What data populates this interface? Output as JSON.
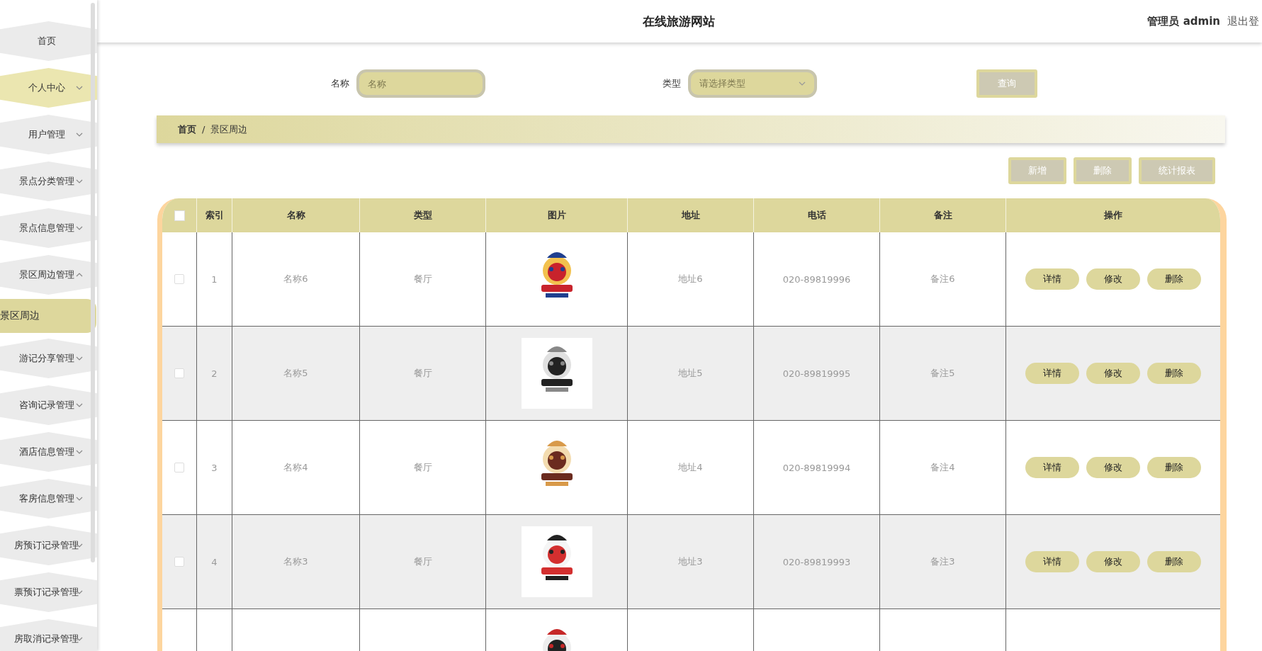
{
  "header": {
    "title": "在线旅游网站",
    "user": "管理员 admin",
    "logout": "退出登"
  },
  "sidebar": {
    "items": [
      {
        "label": "首页",
        "kind": "link",
        "selected": false
      },
      {
        "label": "个人中心",
        "kind": "submenu",
        "selected": true,
        "expanded": false
      },
      {
        "label": "用户管理",
        "kind": "submenu",
        "selected": false,
        "expanded": false
      },
      {
        "label": "景点分类管理",
        "kind": "submenu",
        "selected": false,
        "expanded": false
      },
      {
        "label": "景点信息管理",
        "kind": "submenu",
        "selected": false,
        "expanded": false
      },
      {
        "label": "景区周边管理",
        "kind": "submenu",
        "selected": false,
        "expanded": true,
        "children": [
          {
            "label": "景区周边",
            "selected": true
          }
        ]
      },
      {
        "label": "游记分享管理",
        "kind": "submenu",
        "selected": false,
        "expanded": false
      },
      {
        "label": "咨询记录管理",
        "kind": "submenu",
        "selected": false,
        "expanded": false
      },
      {
        "label": "酒店信息管理",
        "kind": "submenu",
        "selected": false,
        "expanded": false
      },
      {
        "label": "客房信息管理",
        "kind": "submenu",
        "selected": false,
        "expanded": false
      },
      {
        "label": "房预订记录管理",
        "kind": "submenu",
        "selected": false,
        "expanded": false
      },
      {
        "label": "票预订记录管理",
        "kind": "submenu",
        "selected": false,
        "expanded": false
      },
      {
        "label": "房取消记录管理",
        "kind": "submenu",
        "selected": false,
        "expanded": false
      }
    ]
  },
  "search": {
    "name_label": "名称",
    "name_placeholder": "名称",
    "type_label": "类型",
    "type_placeholder": "请选择类型",
    "button": "查询"
  },
  "breadcrumb": [
    "首页",
    "/",
    "景区周边"
  ],
  "toolbar": [
    "新增",
    "删除",
    "统计报表"
  ],
  "table": {
    "select_all": {
      "checked": false
    },
    "columns": [
      "索引",
      "名称",
      "类型",
      "图片",
      "地址",
      "电话",
      "备注",
      "操作"
    ],
    "rows": [
      {
        "kind": "full",
        "checked": false,
        "index": "1",
        "name": "名称6",
        "type": "餐厅",
        "address": "地址6",
        "phone": "020-89819996",
        "note": "备注6",
        "actions": [
          "详情",
          "修改",
          "删除"
        ]
      },
      {
        "kind": "full",
        "checked": false,
        "index": "2",
        "name": "名称5",
        "type": "餐厅",
        "address": "地址5",
        "phone": "020-89819995",
        "note": "备注5",
        "actions": [
          "详情",
          "修改",
          "删除"
        ]
      },
      {
        "kind": "full",
        "checked": false,
        "index": "3",
        "name": "名称4",
        "type": "餐厅",
        "address": "地址4",
        "phone": "020-89819994",
        "note": "备注4",
        "actions": [
          "详情",
          "修改",
          "删除"
        ]
      },
      {
        "kind": "full",
        "checked": false,
        "index": "4",
        "name": "名称3",
        "type": "餐厅",
        "address": "地址3",
        "phone": "020-89819993",
        "note": "备注3",
        "actions": [
          "详情",
          "修改",
          "删除"
        ]
      },
      {
        "kind": "partial"
      }
    ]
  }
}
